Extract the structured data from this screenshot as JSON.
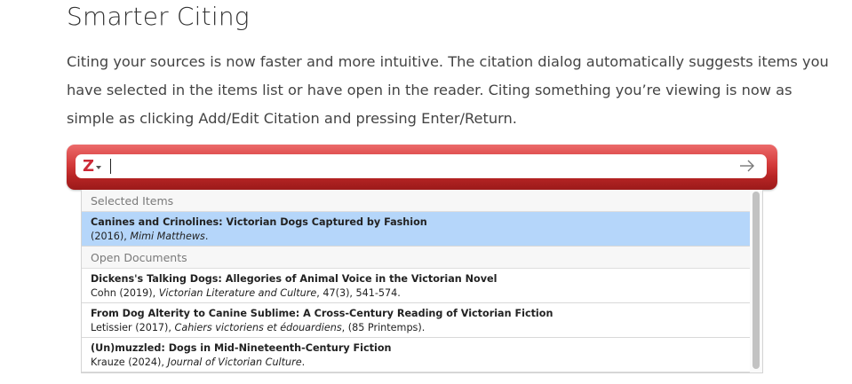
{
  "heading": "Smarter Citing",
  "paragraph": "Citing your sources is now faster and more intuitive. The citation dialog automatically suggests items you have selected in the items list or have open in the reader. Citing something you’re viewing is now as simple as clicking Add/Edit Citation and pressing Enter/Return.",
  "search": {
    "logo_letter": "Z",
    "value": "",
    "placeholder": ""
  },
  "colors": {
    "bar_red": "#c0282b",
    "zotero_red": "#cc2936",
    "selected_row": "#b5d6fa"
  },
  "sections": [
    {
      "header": "Selected Items",
      "items": [
        {
          "title": "Canines and Crinolines: Victorian Dogs Captured by Fashion",
          "meta_prefix": "(2016), ",
          "meta_italic": "Mimi Matthews",
          "meta_suffix": ".",
          "selected": true
        }
      ]
    },
    {
      "header": "Open Documents",
      "items": [
        {
          "title": "Dickens's Talking Dogs: Allegories of Animal Voice in the Victorian Novel",
          "meta_prefix": "Cohn (2019), ",
          "meta_italic": "Victorian Literature and Culture",
          "meta_suffix": ", 47(3), 541-574.",
          "selected": false
        },
        {
          "title": "From Dog Alterity to Canine Sublime: A Cross-Century Reading of Victorian Fiction",
          "meta_prefix": "Letissier (2017), ",
          "meta_italic": "Cahiers victoriens et édouardiens",
          "meta_suffix": ", (85 Printemps).",
          "selected": false
        },
        {
          "title": "(Un)muzzled: Dogs in Mid-Nineteenth-Century Fiction",
          "meta_prefix": "Krauze (2024), ",
          "meta_italic": "Journal of Victorian Culture",
          "meta_suffix": ".",
          "selected": false
        }
      ]
    }
  ]
}
